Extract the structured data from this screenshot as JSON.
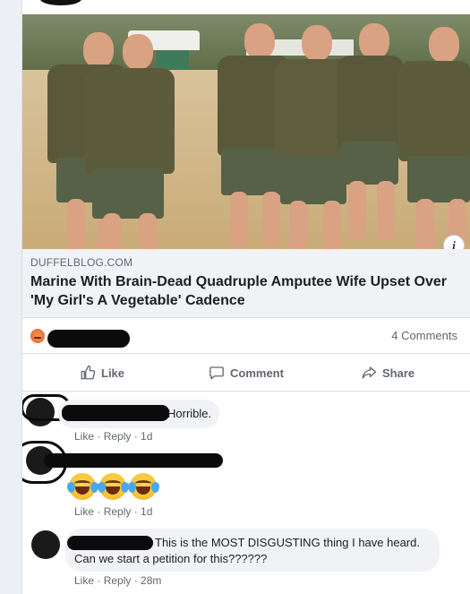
{
  "post": {
    "link_domain": "DUFFELBLOG.COM",
    "link_headline": "Marine With Brain-Dead Quadruple Amputee Wife Upset Over 'My Girl's A Vegetable' Cadence",
    "info_label": "i",
    "reaction_icon": "angry-reaction-icon",
    "comments_count": "4 Comments"
  },
  "actions": {
    "like": "Like",
    "comment": "Comment",
    "share": "Share"
  },
  "comments": [
    {
      "text": "Horrible.",
      "like": "Like",
      "reply": "Reply",
      "time": "1d"
    },
    {
      "text": "",
      "emojis": [
        "laughing-tears-emoji",
        "laughing-tears-emoji",
        "laughing-tears-emoji"
      ],
      "like": "Like",
      "reply": "Reply",
      "time": "1d"
    },
    {
      "text_line1": "This is the MOST DISGUSTING thing I have heard.",
      "text_line2": "Can we start a petition for this??????",
      "like": "Like",
      "reply": "Reply",
      "time": "28m"
    }
  ],
  "colors": {
    "accent_link": "#385898",
    "muted_text": "#606770",
    "card_bg": "#ffffff",
    "link_bg": "#f0f2f5"
  }
}
